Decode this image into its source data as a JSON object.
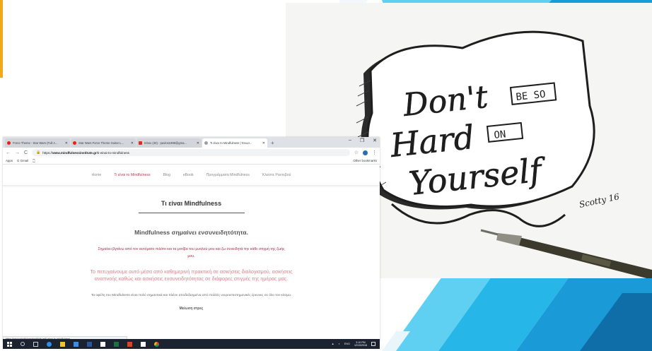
{
  "slide": {
    "accent_color": "#f0a81c",
    "shape_colors": [
      "#1b9ad8",
      "#26b6e8",
      "#5fcff2",
      "#0f6ea8"
    ]
  },
  "artwork": {
    "lines": [
      "Don't",
      "BE SO",
      "Hard",
      "ON",
      "Yourself"
    ],
    "signature": "Scotty 16",
    "object": "pen"
  },
  "browser": {
    "tabs": [
      {
        "title": "Force Theme - Star Wars (Full A...",
        "icon_color": "#e62117",
        "icon": "youtube-icon",
        "active": false
      },
      {
        "title": "Star Wars Force Theme Guitar L...",
        "icon_color": "#e62117",
        "icon": "youtube-icon",
        "active": false
      },
      {
        "title": "Inbox (30) - pavlos1998@gma...",
        "icon_color": "#d93025",
        "icon": "gmail-icon",
        "active": false
      },
      {
        "title": "Τι είναι το Mindfulness | Ένωσ...",
        "icon_color": "#9aa0a6",
        "icon": "page-icon",
        "active": true
      }
    ],
    "new_tab": "+",
    "window_controls": [
      "–",
      "❐",
      "✕"
    ],
    "toolbar": {
      "back": "←",
      "forward": "→",
      "reload": "C",
      "lock": "🔒",
      "url_prefix": "https://",
      "url_host": "www.mindfulnessinstitute.gr",
      "url_path": "/ti-einai-to-mindfulness",
      "star": "☆",
      "menu": "⋮"
    },
    "bookmarks": {
      "items": [
        "Apps",
        "G Gmail",
        "🗋"
      ],
      "other": "Other bookmarks"
    },
    "status_url": "https://www.mindfulnessinstitute.gr/ti-einai-to-mindfulness",
    "site": {
      "nav": [
        {
          "label": "Home",
          "current": false
        },
        {
          "label": "Τι είναι το Mindfulness",
          "current": true
        },
        {
          "label": "Blog",
          "current": false
        },
        {
          "label": "eBook",
          "current": false
        },
        {
          "label": "Προγράμματα Mindfulness",
          "current": false
        },
        {
          "label": "Κλείστε Ραντεβού",
          "current": false
        }
      ],
      "title": "Τι είναι Mindfulness",
      "lead": "Mindfulness σημαίνει ενσυνειδητότητα.",
      "para_red": "Σημαίνει βγαίνω από τον αυτόματο πιλότο και τα μοτίβα του μυαλού μου και ζω συνειδητά την κάθε στιγμή της ζωής μου.",
      "para_pink": "Το πετυχαίνουμε αυτό μέσα από καθημερινή πρακτική σε ασκήσεις διαλογισμού, ασκήσεις αναπνοής καθώς και ασκήσεις ενσυνειδητότητας σε διάφορες στιγμές της ημέρας μας.",
      "para_gray": "Τα οφέλη του Mindfulness είναι πολύ σημαντικά και πλέον αποδεδειγμένα από πολλές νευροεπιστημονικές έρευνες σε όλο τον κόσμο.",
      "subheading": "Μείωση στρες"
    }
  },
  "taskbar": {
    "icons": [
      {
        "name": "windows-start-icon",
        "color": "#ffffff"
      },
      {
        "name": "search-icon",
        "color": "#cccccc"
      },
      {
        "name": "task-view-icon",
        "color": "#cccccc"
      },
      {
        "name": "edge-icon",
        "color": "#2f8de4"
      },
      {
        "name": "file-explorer-icon",
        "color": "#f2c230"
      },
      {
        "name": "store-icon",
        "color": "#3a8ee6"
      },
      {
        "name": "word-icon",
        "color": "#2b5797"
      },
      {
        "name": "app-icon",
        "color": "#ffffff"
      },
      {
        "name": "excel-icon",
        "color": "#1d7044"
      },
      {
        "name": "powerpoint-icon",
        "color": "#d24726"
      },
      {
        "name": "mail-icon",
        "color": "#ffffff"
      },
      {
        "name": "chrome-icon",
        "color": "#f4b400"
      }
    ],
    "tray_text": "ENG",
    "time": "3:10 PM",
    "date": "12/10/2018"
  }
}
